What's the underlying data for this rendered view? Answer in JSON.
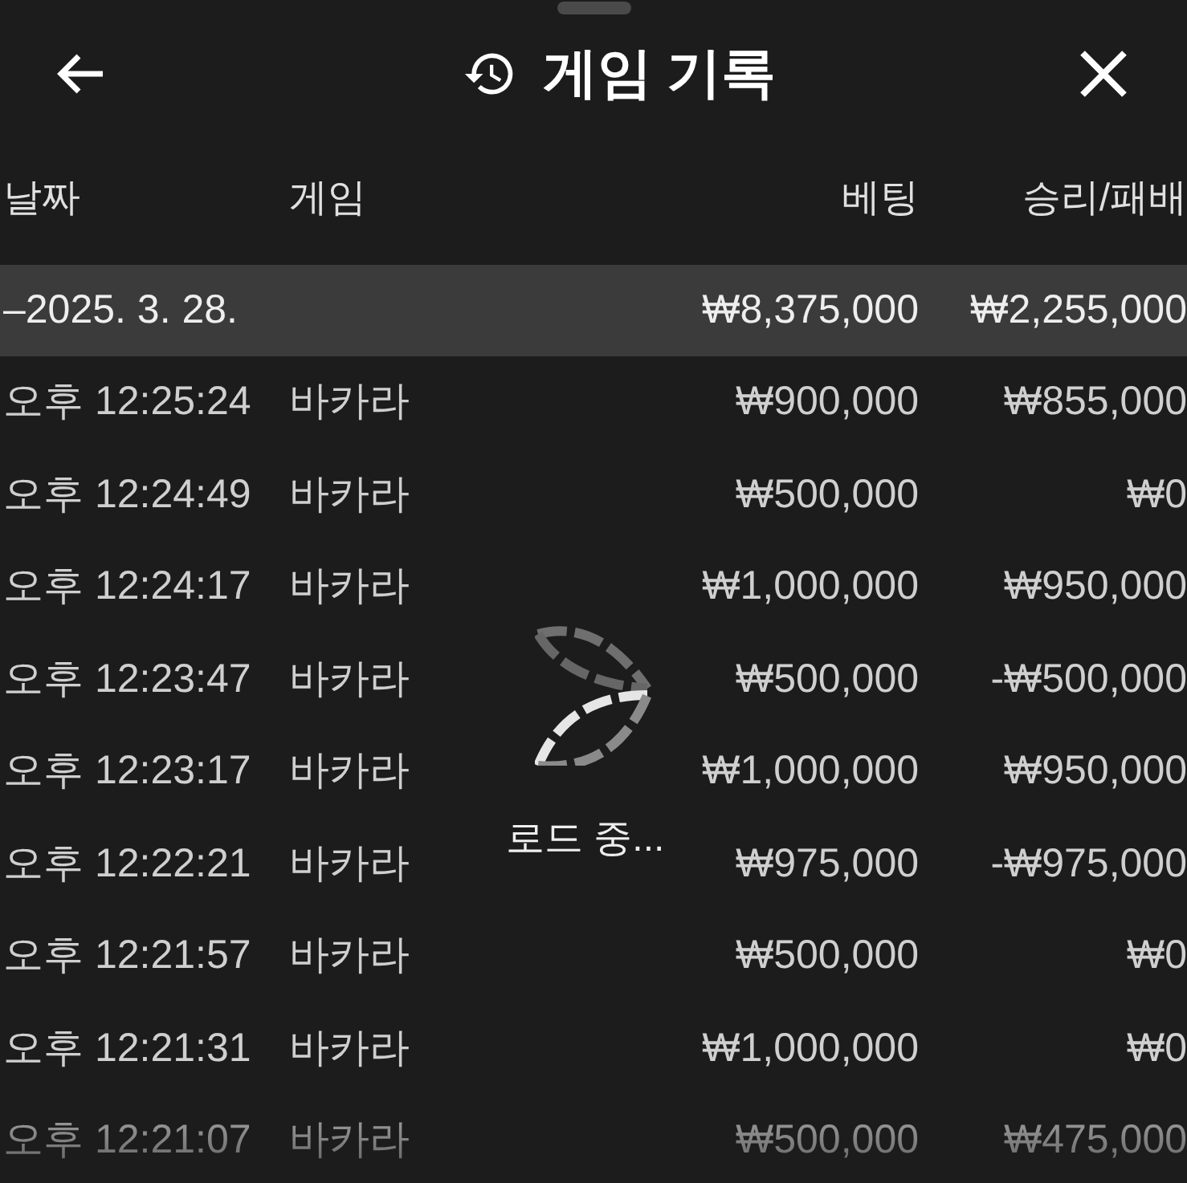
{
  "header": {
    "title": "게임 기록"
  },
  "table": {
    "columns": [
      "날짜",
      "게임",
      "베팅",
      "승리/패배"
    ],
    "group": {
      "toggle": "–",
      "date": "2025. 3. 28.",
      "bet": "₩8,375,000",
      "result": "₩2,255,000"
    },
    "rows": [
      {
        "time": "오후 12:25:24",
        "game": "바카라",
        "bet": "₩900,000",
        "result": "₩855,000"
      },
      {
        "time": "오후 12:24:49",
        "game": "바카라",
        "bet": "₩500,000",
        "result": "₩0"
      },
      {
        "time": "오후 12:24:17",
        "game": "바카라",
        "bet": "₩1,000,000",
        "result": "₩950,000"
      },
      {
        "time": "오후 12:23:47",
        "game": "바카라",
        "bet": "₩500,000",
        "result": "-₩500,000"
      },
      {
        "time": "오후 12:23:17",
        "game": "바카라",
        "bet": "₩1,000,000",
        "result": "₩950,000"
      },
      {
        "time": "오후 12:22:21",
        "game": "바카라",
        "bet": "₩975,000",
        "result": "-₩975,000"
      },
      {
        "time": "오후 12:21:57",
        "game": "바카라",
        "bet": "₩500,000",
        "result": "₩0"
      },
      {
        "time": "오후 12:21:31",
        "game": "바카라",
        "bet": "₩1,000,000",
        "result": "₩0"
      },
      {
        "time": "오후 12:21:07",
        "game": "바카라",
        "bet": "₩500,000",
        "result": "₩475,000"
      }
    ]
  },
  "loading": {
    "label": "로드 중..."
  }
}
